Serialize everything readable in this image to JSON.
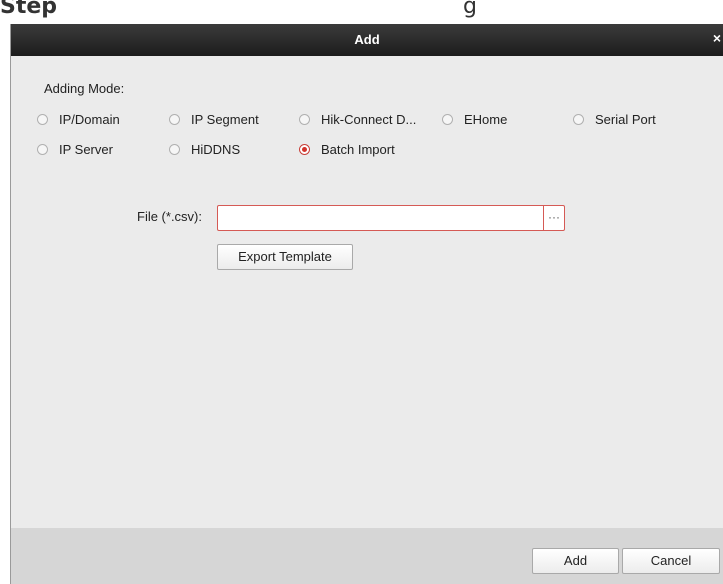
{
  "page_fragment": {
    "left_text": "Step",
    "right_text": "g"
  },
  "dialog": {
    "title": "Add",
    "close_glyph": "×"
  },
  "adding_mode": {
    "label": "Adding Mode:",
    "options": [
      {
        "label": "IP/Domain",
        "selected": false
      },
      {
        "label": "IP Segment",
        "selected": false
      },
      {
        "label": "Hik-Connect D...",
        "selected": false
      },
      {
        "label": "EHome",
        "selected": false
      },
      {
        "label": "Serial Port",
        "selected": false
      },
      {
        "label": "IP Server",
        "selected": false
      },
      {
        "label": "HiDDNS",
        "selected": false
      },
      {
        "label": "Batch Import",
        "selected": true
      }
    ]
  },
  "file": {
    "label": "File (*.csv):",
    "value": "",
    "browse_glyph": "···"
  },
  "export_template": {
    "label": "Export Template"
  },
  "footer": {
    "add_label": "Add",
    "cancel_label": "Cancel"
  },
  "colors": {
    "titlebar": "#2a2a2a",
    "panel": "#ebebeb",
    "footer": "#d6d6d6",
    "accent_red": "#d2332b"
  }
}
